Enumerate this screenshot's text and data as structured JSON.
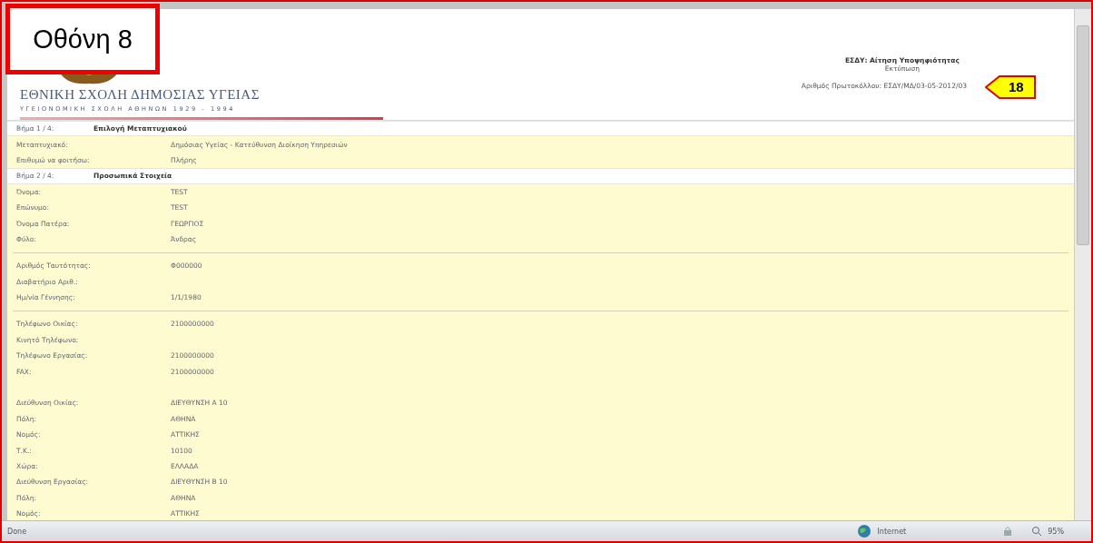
{
  "annotation": {
    "screen_label": "Οθόνη 8",
    "callout_number": "18"
  },
  "header": {
    "school_name": "ΕΘΝΙΚΗ ΣΧΟΛΗ ΔΗΜΟΣΙΑΣ ΥΓΕΙΑΣ",
    "school_subtitle": "ΥΓΕΙΟΝΟΜΙΚΗ ΣΧΟΛΗ ΑΘΗΝΩΝ 1929 - 1994",
    "title": "ΕΣΔΥ: Αίτηση Υποψηφιότητας",
    "subtitle": "Εκτύπωση",
    "protocol": "Αριθμός Πρωτοκόλλου: ΕΣΔΥ/ΜΔ/03-05-2012/03"
  },
  "rows": [
    {
      "kind": "step",
      "label": "Βήμα 1 / 4:",
      "value": "Επιλογή Μεταπτυχιακού"
    },
    {
      "kind": "field",
      "label": "Μεταπτυχιακό:",
      "value": "Δημόσιας Υγείας - Κατεύθυνση Διοίκηση Υπηρεσιών"
    },
    {
      "kind": "field",
      "label": "Επιθυμώ να φοιτήσω:",
      "value": "Πλήρης"
    },
    {
      "kind": "step",
      "label": "Βήμα 2 / 4:",
      "value": "Προσωπικά Στοιχεία"
    },
    {
      "kind": "field",
      "label": "Όνομα:",
      "value": "TEST"
    },
    {
      "kind": "field",
      "label": "Επώνυμο:",
      "value": "TEST"
    },
    {
      "kind": "field",
      "label": "Όνομα Πατέρα:",
      "value": "ΓΕΩΡΓΙΟΣ"
    },
    {
      "kind": "field",
      "label": "Φύλο:",
      "value": "Άνδρας"
    },
    {
      "kind": "divider"
    },
    {
      "kind": "field",
      "label": "Αριθμός Ταυτότητας:",
      "value": "Φ000000"
    },
    {
      "kind": "field",
      "label": "Διαβατήριο Αριθ.:"
    },
    {
      "kind": "field",
      "label": "Ημ/νία Γέννησης:",
      "value": "1/1/1980"
    },
    {
      "kind": "divider"
    },
    {
      "kind": "field",
      "label": "Τηλέφωνο Οικίας:",
      "value": "2100000000"
    },
    {
      "kind": "field",
      "label": "Κινητό Τηλέφωνο:"
    },
    {
      "kind": "field",
      "label": "Τηλέφωνο Εργασίας:",
      "value": "2100000000"
    },
    {
      "kind": "field",
      "label": "FAX:",
      "value": "2100000000"
    },
    {
      "kind": "gap"
    },
    {
      "kind": "field",
      "label": "Διεύθυνση Οικίας:",
      "value": "ΔΙΕΥΘΥΝΣΗ Α 10"
    },
    {
      "kind": "field",
      "label": "Πόλη:",
      "value": "ΑΘΗΝΑ"
    },
    {
      "kind": "field",
      "label": "Νομός:",
      "value": "ΑΤΤΙΚΗΣ"
    },
    {
      "kind": "field",
      "label": "Τ.Κ.:",
      "value": "10100"
    },
    {
      "kind": "field",
      "label": "Χώρα:",
      "value": "ΕΛΛΑΔΑ"
    },
    {
      "kind": "field",
      "label": "Διεύθυνση Εργασίας:",
      "value": "ΔΙΕΥΘΥΝΣΗ Β 10"
    },
    {
      "kind": "field",
      "label": "Πόλη:",
      "value": "ΑΘΗΝΑ"
    },
    {
      "kind": "field",
      "label": "Νομός:",
      "value": "ΑΤΤΙΚΗΣ"
    }
  ],
  "status_bar": {
    "status": "Done",
    "zone": "Internet",
    "zoom": "95%"
  }
}
